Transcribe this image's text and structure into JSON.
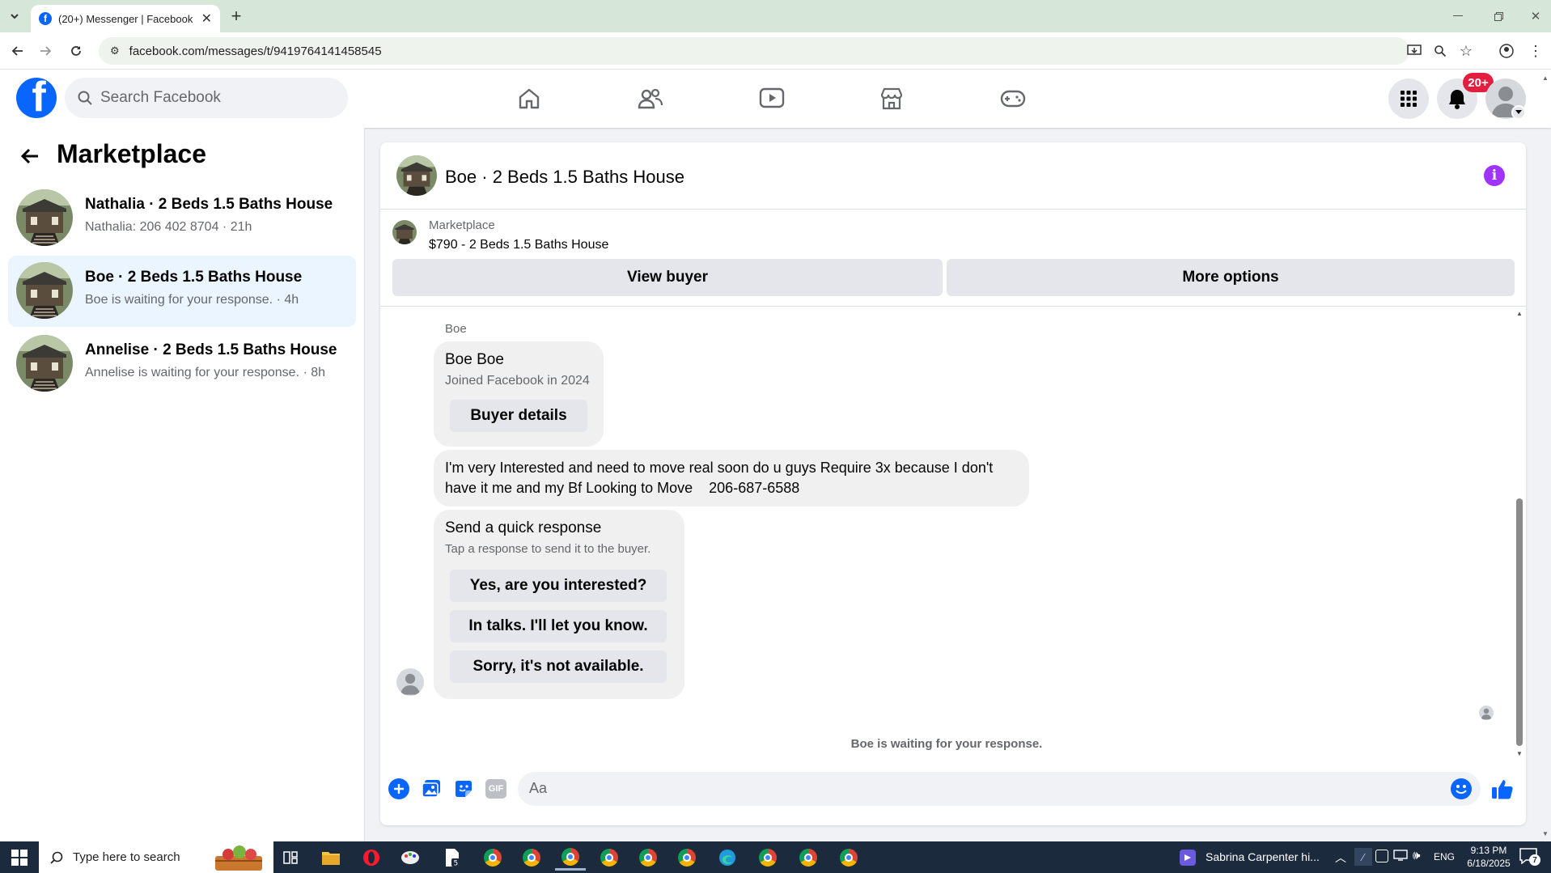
{
  "browser": {
    "tab_title": "(20+) Messenger | Facebook",
    "url": "facebook.com/messages/t/9419764141458545"
  },
  "header": {
    "search_placeholder": "Search Facebook",
    "notification_count": "20+"
  },
  "sidebar": {
    "title": "Marketplace",
    "conversations": [
      {
        "name": "Nathalia · 2 Beds 1.5 Baths House",
        "preview": "Nathalia: 206 402 8704 · 21h"
      },
      {
        "name": "Boe · 2 Beds 1.5 Baths House",
        "preview": "Boe is waiting for your response. · 4h"
      },
      {
        "name": "Annelise · 2 Beds 1.5 Baths House",
        "preview": "Annelise is waiting for your response. · 8h"
      }
    ]
  },
  "chat": {
    "title": "Boe · 2 Beds 1.5 Baths House",
    "listing_source": "Marketplace",
    "listing_title": "$790 - 2 Beds 1.5 Baths House",
    "view_buyer_label": "View buyer",
    "more_options_label": "More options",
    "sender_label": "Boe",
    "profile_card": {
      "name": "Boe Boe",
      "joined": "Joined Facebook in 2024",
      "button": "Buyer details"
    },
    "message_line1": "I'm very Interested and need to move real soon do u guys Require 3x because I don't",
    "message_line2": "have it me and my Bf Looking to Move    206-687-6588",
    "quick_response": {
      "title": "Send a quick response",
      "subtitle": "Tap a response to send it to the buyer.",
      "options": [
        "Yes, are you interested?",
        "In talks. I'll let you know.",
        "Sorry, it's not available."
      ]
    },
    "status": "Boe is waiting for your response.",
    "composer_placeholder": "Aa",
    "gif_label": "GIF"
  },
  "taskbar": {
    "search_placeholder": "Type here to search",
    "media_title": "Sabrina Carpenter hi...",
    "language": "ENG",
    "time": "9:13 PM",
    "date": "6/18/2025",
    "notification_badge": "7"
  },
  "colors": {
    "facebook_blue": "#0866ff",
    "badge_red": "#e41e3f",
    "info_purple": "#a033ff",
    "selected_conv_bg": "#ebf5ff"
  }
}
